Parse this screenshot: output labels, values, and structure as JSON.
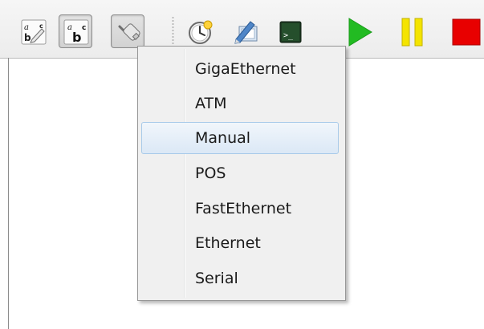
{
  "toolbar": {
    "buttons": [
      {
        "id": "text-label-edit",
        "icon": "text-pencil-icon",
        "checked": false
      },
      {
        "id": "text-label-bold",
        "icon": "text-bold-abc-icon",
        "checked": true
      },
      {
        "id": "add-link",
        "icon": "cable-link-icon",
        "checked": true
      },
      {
        "id": "capture",
        "icon": "clock-capture-icon",
        "checked": false
      },
      {
        "id": "console-all",
        "icon": "screen-pen-icon",
        "checked": false
      },
      {
        "id": "console",
        "icon": "terminal-icon",
        "checked": false
      },
      {
        "id": "start",
        "icon": "play-icon",
        "color": "#22bb22"
      },
      {
        "id": "suspend",
        "icon": "pause-icon",
        "color": "#e6d200"
      },
      {
        "id": "stop",
        "icon": "stop-icon",
        "color": "#e00000"
      }
    ]
  },
  "link_type_menu": {
    "highlighted": "Manual",
    "items": [
      "GigaEthernet",
      "ATM",
      "Manual",
      "POS",
      "FastEthernet",
      "Ethernet",
      "Serial"
    ]
  }
}
